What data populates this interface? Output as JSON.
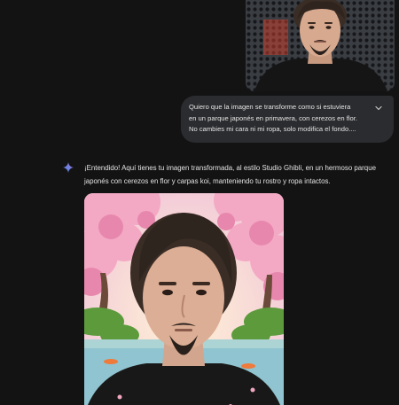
{
  "conversation": {
    "user_message": {
      "attachment_alt": "Foto del usuario",
      "lines": [
        "Quiero que la imagen se transforme como si estuviera",
        "en un parque japonés en primavera, con cerezos en flor.",
        "No cambies mi cara ni mi ropa, solo modifica el fondo...."
      ],
      "expand_icon": "chevron-down-icon"
    },
    "model_response": {
      "avatar_icon": "gemini-sparkle-icon",
      "lines": [
        "¡Entendido! Aquí tienes tu imagen transformada, al estilo Studio Ghibli, en un hermoso parque",
        "japonés con cerezos en flor y carpas koi, manteniendo tu rostro y ropa intactos."
      ],
      "image_alt": "Imagen generada con cerezos en flor"
    }
  },
  "colors": {
    "background": "#131314",
    "bubble": "#2b2c2f",
    "text": "#e3e3e3",
    "sparkle_blue": "#4e8df5",
    "sparkle_purple": "#9b72cb"
  }
}
